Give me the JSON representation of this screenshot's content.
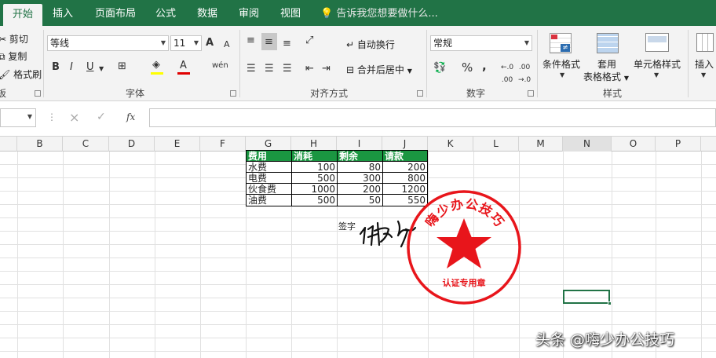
{
  "tabs": [
    "开始",
    "插入",
    "页面布局",
    "公式",
    "数据",
    "审阅",
    "视图"
  ],
  "tellme": "告诉我您想要做什么...",
  "clipboard": {
    "cut": "剪切",
    "copy": "复制",
    "painter": "格式刷",
    "group": "板"
  },
  "font": {
    "name": "等线",
    "size": "11",
    "group": "字体",
    "bold": "B",
    "italic": "I",
    "underline": "U",
    "grow": "A",
    "shrink": "A",
    "color_a": "A",
    "wen": "wén"
  },
  "align": {
    "wrap": "自动换行",
    "merge": "合并后居中",
    "group": "对齐方式"
  },
  "number": {
    "format": "常规",
    "percent": "%",
    "comma": ",",
    "group": "数字"
  },
  "styles": {
    "cond": "条件格式",
    "table1": "套用",
    "table2": "表格格式",
    "cell": "单元格样式",
    "group": "样式"
  },
  "cells": {
    "insert": "插入"
  },
  "formula": {
    "fx": "fx",
    "cancel": "×",
    "enter": "✓",
    "value": ""
  },
  "columns": [
    "B",
    "C",
    "D",
    "E",
    "F",
    "G",
    "H",
    "I",
    "J",
    "K",
    "L",
    "M",
    "N",
    "O",
    "P"
  ],
  "table": {
    "headers": [
      "费用",
      "消耗",
      "剩余",
      "请款"
    ],
    "rows": [
      [
        "水费",
        "100",
        "80",
        "200"
      ],
      [
        "电费",
        "500",
        "300",
        "800"
      ],
      [
        "伙食费",
        "1000",
        "200",
        "1200"
      ],
      [
        "油费",
        "500",
        "50",
        "550"
      ]
    ]
  },
  "sign_label": "签字",
  "stamp": {
    "top_text": "嗨少办公技巧",
    "bottom_text": "认证专用章",
    "color": "#e8151b"
  },
  "watermark": "头条 @嗨少办公技巧",
  "theme": {
    "excel_green": "#217346",
    "header_green": "#1a9641"
  }
}
